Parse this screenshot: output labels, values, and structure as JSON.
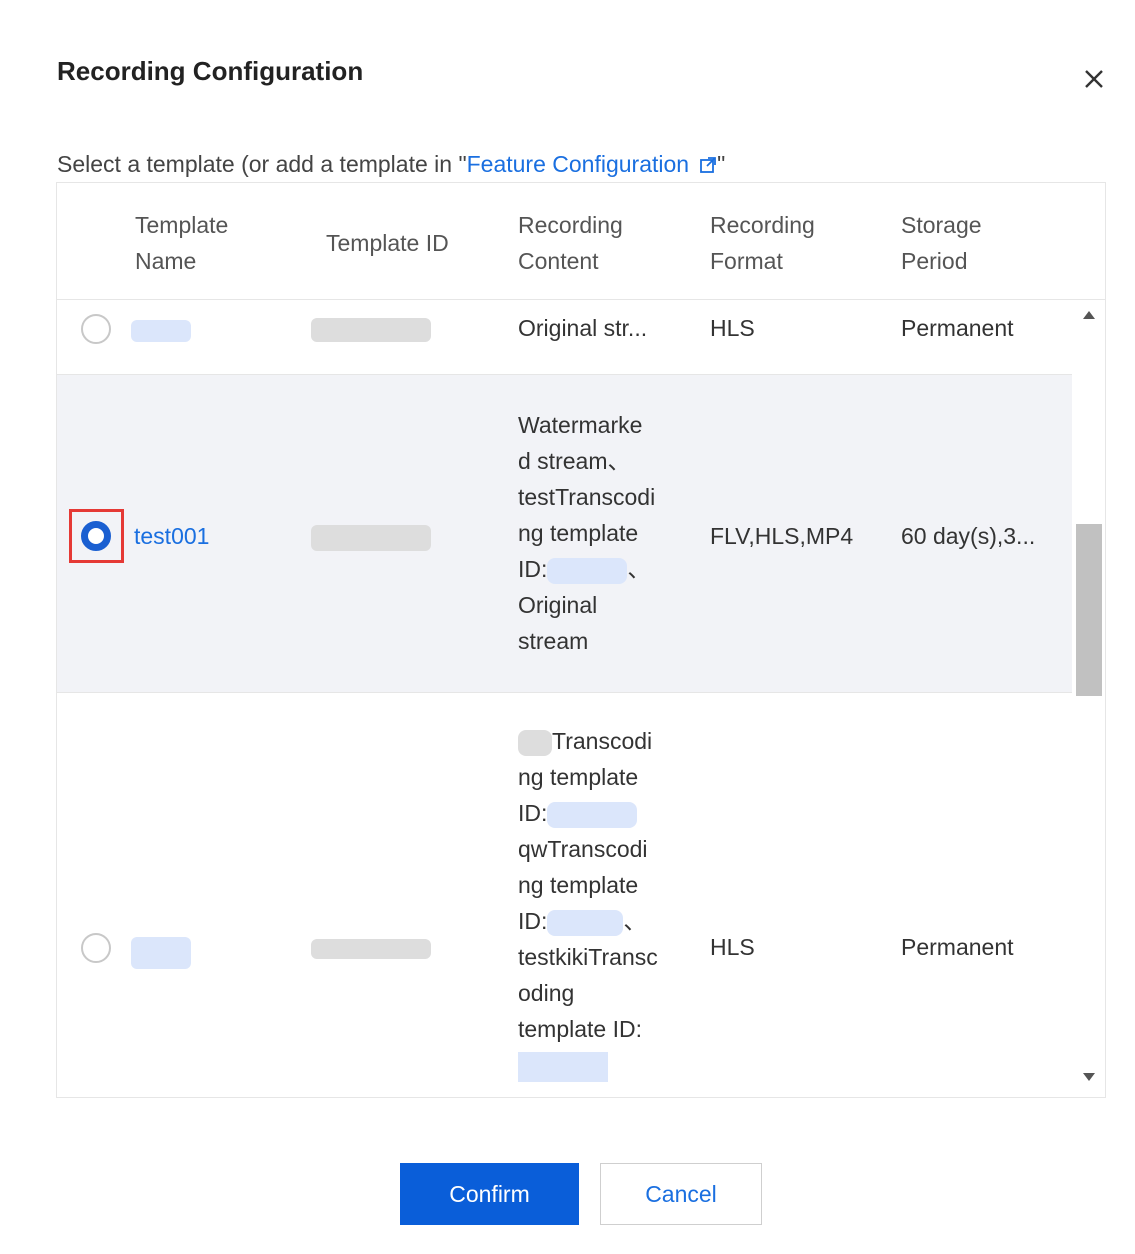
{
  "dialog": {
    "title": "Recording Configuration",
    "close_icon": "close-icon",
    "subtitle_prefix": "Select a template (or add a template in \"",
    "subtitle_link": "Feature Configuration",
    "subtitle_suffix": "\""
  },
  "table": {
    "headers": {
      "template_name": [
        "Template",
        "Name"
      ],
      "template_id": "Template ID",
      "recording_content": [
        "Recording",
        "Content"
      ],
      "recording_format": [
        "Recording",
        "Format"
      ],
      "storage_period": [
        "Storage",
        "Period"
      ]
    },
    "rows": [
      {
        "selected": false,
        "template_name": "",
        "template_id": "",
        "content_lines": [
          "Original str..."
        ],
        "format": "HLS",
        "storage": "Permanent"
      },
      {
        "selected": true,
        "template_name": "test001",
        "template_id": "",
        "content_lines": [
          "Watermarke",
          "d stream、",
          "testTranscodi",
          "ng template",
          "ID:",
          "Original",
          "stream"
        ],
        "content_id_suffix": "、",
        "format": "FLV,HLS,MP4",
        "storage": "60 day(s),3..."
      },
      {
        "selected": false,
        "template_name": "",
        "template_id": "",
        "content_lines": [
          "Transcodi",
          "ng template",
          "ID:",
          "qwTranscodi",
          "ng template",
          "ID:",
          "testkikiTransc",
          "oding",
          "template ID:"
        ],
        "content_id_suffix": "、",
        "format": "HLS",
        "storage": "Permanent"
      }
    ]
  },
  "buttons": {
    "confirm": "Confirm",
    "cancel": "Cancel"
  },
  "colors": {
    "primary": "#0a5ed9",
    "link": "#1a6fe0",
    "highlight": "#e53935",
    "selected_row": "#f2f3f7"
  }
}
